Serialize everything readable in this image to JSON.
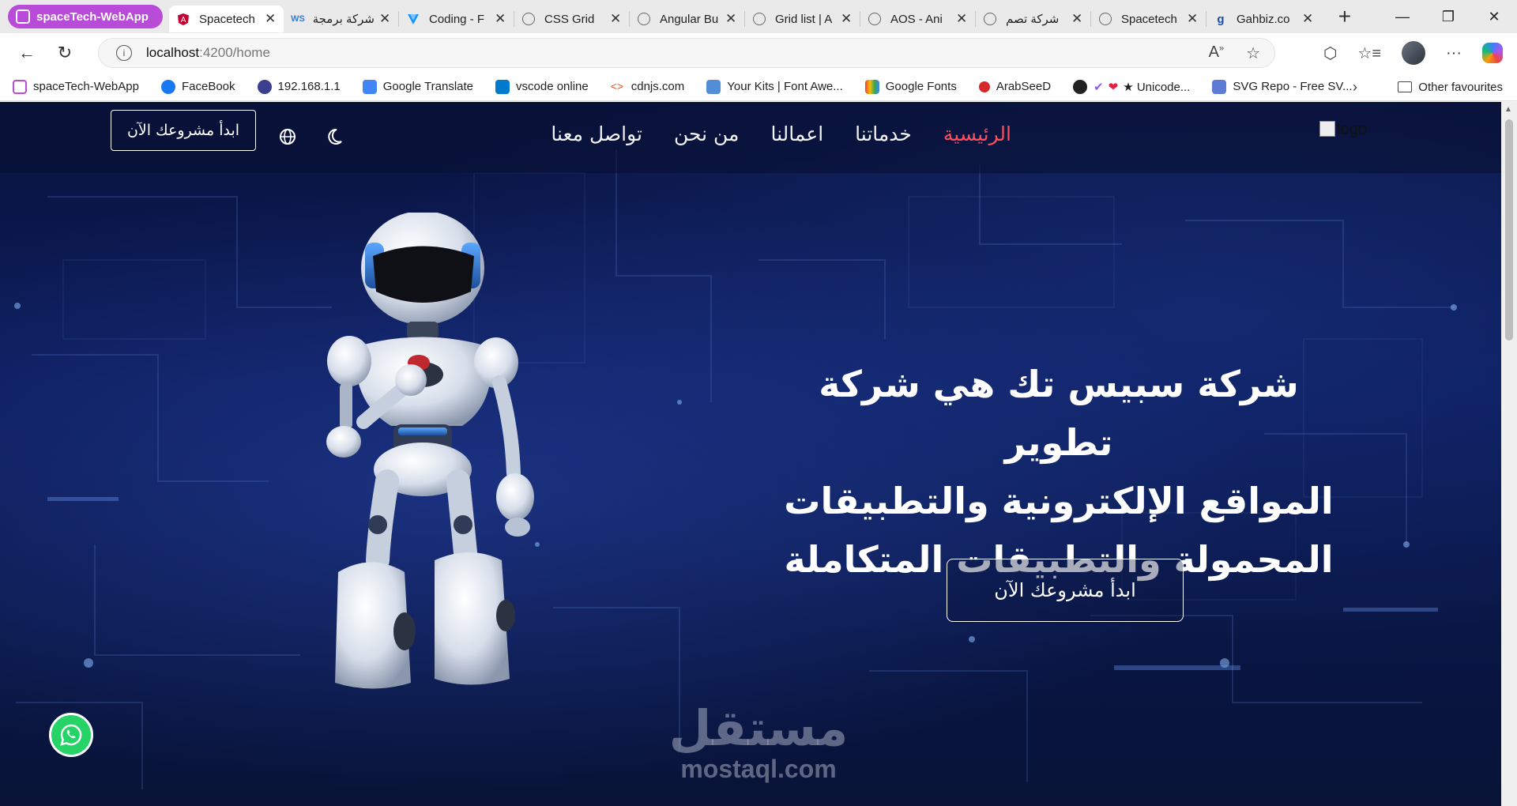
{
  "browser": {
    "tab_group": "spaceTech-WebApp",
    "tabs": [
      {
        "label": "Spacetech",
        "active": true,
        "icon": "angular-icon"
      },
      {
        "label": "شركة برمجة",
        "icon": "ws-icon"
      },
      {
        "label": "Coding - F",
        "icon": "vuetify-icon"
      },
      {
        "label": "CSS Grid",
        "icon": "globe-icon"
      },
      {
        "label": "Angular Bu",
        "icon": "globe-icon"
      },
      {
        "label": "Grid list | A",
        "icon": "globe-icon"
      },
      {
        "label": "AOS - Ani",
        "icon": "globe-icon"
      },
      {
        "label": "شركة تصم",
        "icon": "globe-icon"
      },
      {
        "label": "Spacetech",
        "icon": "globe-icon"
      },
      {
        "label": "Gahbiz.co",
        "icon": "g-icon"
      }
    ],
    "url_host": "localhost",
    "url_path": ":4200/home",
    "bookmarks": [
      {
        "label": "spaceTech-WebApp",
        "color": "#b84bd8"
      },
      {
        "label": "FaceBook",
        "color": "#1877f2"
      },
      {
        "label": "192.168.1.1",
        "color": "#3a3f8f"
      },
      {
        "label": "Google Translate",
        "color": "#4285f4"
      },
      {
        "label": "vscode online",
        "color": "#007acc"
      },
      {
        "label": "cdnjs.com",
        "color": "#e95420"
      },
      {
        "label": "Your Kits | Font Awe...",
        "color": "#528dd7"
      },
      {
        "label": "Google Fonts",
        "color": "#34a853"
      },
      {
        "label": "ArabSeeD",
        "color": "#d62828"
      },
      {
        "label": "★ Unicode...",
        "color": "#222222"
      },
      {
        "label": "SVG Repo - Free SV...",
        "color": "#5b7bd5"
      }
    ],
    "other_favourites": "Other favourites"
  },
  "site": {
    "logo_alt": "logo",
    "menu": [
      {
        "label": "الرئيسية",
        "active": true
      },
      {
        "label": "خدماتنا"
      },
      {
        "label": "اعمالنا"
      },
      {
        "label": "من نحن"
      },
      {
        "label": "تواصل معنا"
      }
    ],
    "cta_nav": "ابدأ مشروعك الآن",
    "hero_title_lines": [
      "شركة سبيس تك هي شركة تطوير",
      "المواقع الإلكترونية والتطبيقات",
      "المحمولة والتطبيقات المتكاملة"
    ],
    "cta_hero": "ابدأ مشروعك الآن",
    "accent_color": "#ff4d5c"
  },
  "watermark": {
    "arabic": "مستقل",
    "latin": "mostaql.com"
  }
}
